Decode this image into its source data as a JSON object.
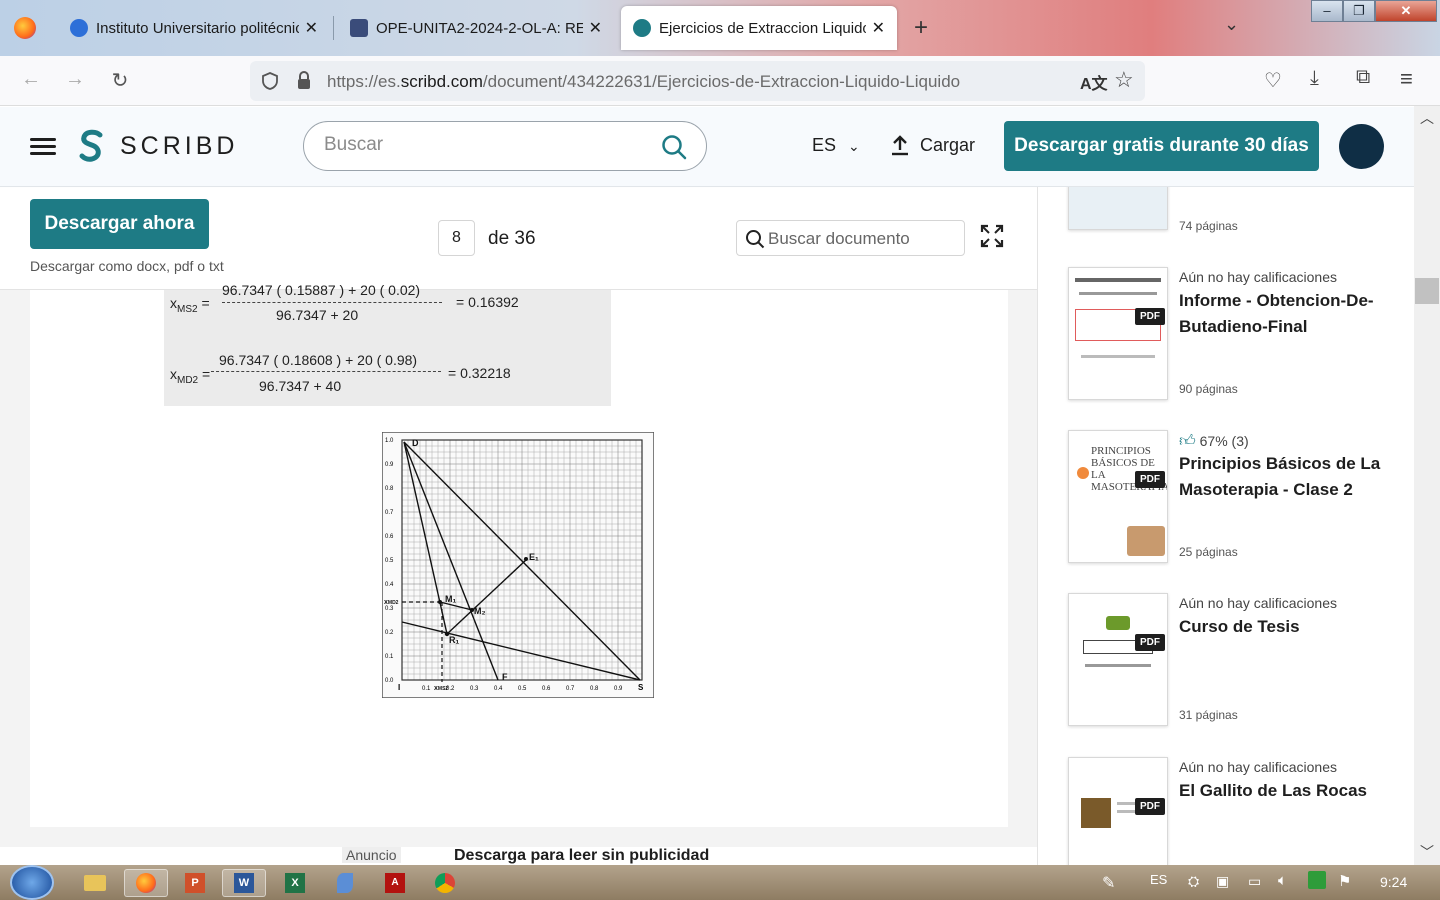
{
  "browser": {
    "tabs": [
      {
        "title": "Instituto Universitario politécnico",
        "active": false
      },
      {
        "title": "OPE-UNITA2-2024-2-OL-A: REVIEW",
        "active": false
      },
      {
        "title": "Ejercicios de Extraccion Liquido-Liquido",
        "active": true
      }
    ],
    "url_prefix": "https://es.",
    "url_domain": "scribd.com",
    "url_path": "/document/434222631/Ejercicios-de-Extraccion-Liquido-Liquido"
  },
  "header": {
    "logo_text": "SCRIBD",
    "search_placeholder": "Buscar",
    "language": "ES",
    "upload_label": "Cargar",
    "cta_label": "Descargar gratis durante 30 días"
  },
  "toolbar": {
    "download_label": "Descargar ahora",
    "download_sub": "Descargar como docx, pdf o txt",
    "page_current": "8",
    "page_of": "de 36",
    "doc_search_placeholder": "Buscar documento"
  },
  "document": {
    "formula1_lhs": "x",
    "formula1_sub": "MS2",
    "formula1_num": "96.7347 ( 0.15887 ) + 20 ( 0.02)",
    "formula1_den": "96.7347 + 20",
    "formula1_result": "= 0.16392",
    "formula2_lhs": "x",
    "formula2_sub": "MD2",
    "formula2_num": "96.7347 ( 0.18608 ) + 20 ( 0.98)",
    "formula2_den": "96.7347 + 40",
    "formula2_result": "= 0.32218",
    "chart_y_ticks": [
      "1.0",
      "0.9",
      "0.8",
      "0.7",
      "0.6",
      "0.5",
      "0.4",
      "0.3",
      "0.2",
      "0.1",
      "0.0"
    ],
    "chart_x_ticks": [
      "I",
      "0.1",
      "0.2",
      "0.3",
      "0.4",
      "0.5",
      "0.6",
      "0.7",
      "0.8",
      "0.9",
      "S"
    ],
    "chart_labels": {
      "D": "D",
      "E1": "E₁",
      "M1": "M₁",
      "M2": "M₂",
      "R1": "R₁",
      "F": "F",
      "xMD2": "x",
      "xMD2_sub": "MD2",
      "xMS2": "x",
      "xMS2_sub": "MS2"
    },
    "ad_label": "Anuncio",
    "ad_text": "Descarga para leer sin publicidad"
  },
  "sidebar": {
    "cards": [
      {
        "rating": "",
        "title": "",
        "pages": "74 páginas"
      },
      {
        "rating": "Aún no hay calificaciones",
        "title": "Informe - Obtencion-De-Butadieno-Final",
        "pages": "90 páginas",
        "badge": "PDF"
      },
      {
        "rating": "67% (3)",
        "title": "Principios Básicos de La Masoterapia - Clase 2",
        "pages": "25 páginas",
        "badge": "PDF",
        "thumb_title": "PRINCIPIOS BÁSICOS DE LA MASOTERAPIA"
      },
      {
        "rating": "Aún no hay calificaciones",
        "title": "Curso de Tesis",
        "pages": "31 páginas",
        "badge": "PDF"
      },
      {
        "rating": "Aún no hay calificaciones",
        "title": "El Gallito de Las Rocas",
        "pages": "",
        "badge": "PDF"
      }
    ]
  },
  "taskbar": {
    "language": "ES",
    "clock": "9:24"
  }
}
